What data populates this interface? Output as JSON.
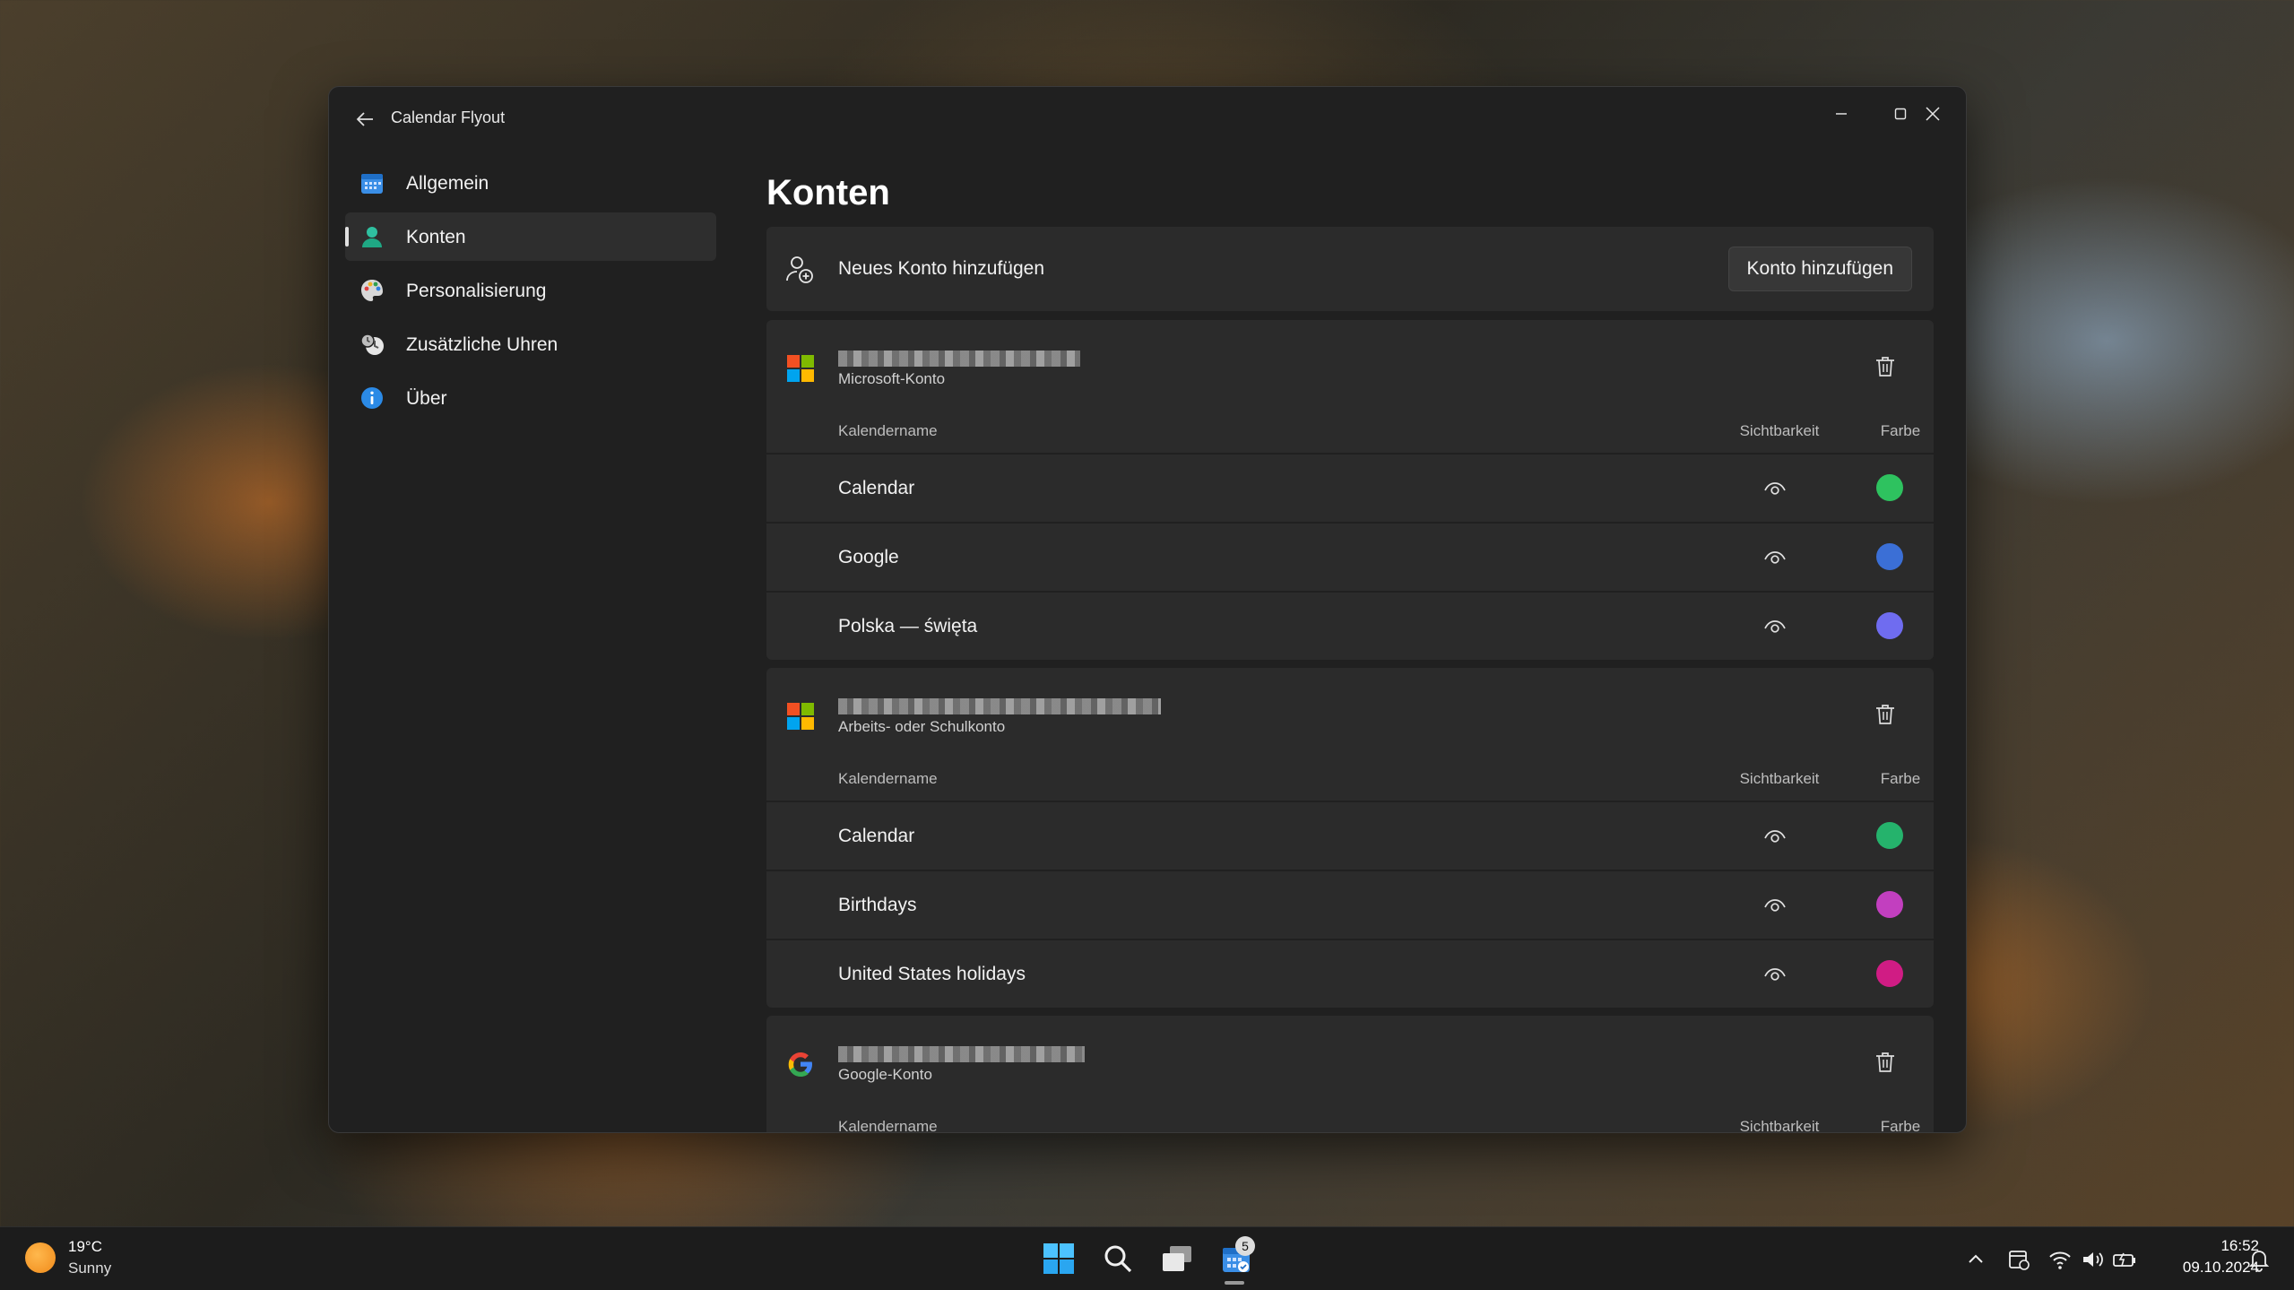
{
  "window": {
    "title": "Calendar Flyout"
  },
  "sidebar": {
    "items": [
      {
        "label": "Allgemein",
        "icon": "calendar-icon",
        "active": false
      },
      {
        "label": "Konten",
        "icon": "person-icon",
        "active": true
      },
      {
        "label": "Personalisierung",
        "icon": "palette-icon",
        "active": false
      },
      {
        "label": "Zusätzliche Uhren",
        "icon": "clock-icon",
        "active": false
      },
      {
        "label": "Über",
        "icon": "info-icon",
        "active": false
      }
    ]
  },
  "main": {
    "title": "Konten",
    "add_account": {
      "text": "Neues Konto hinzufügen",
      "button_label": "Konto hinzufügen"
    },
    "column_headers": {
      "name": "Kalendername",
      "visibility": "Sichtbarkeit",
      "color": "Farbe"
    },
    "accounts": [
      {
        "type_label": "Microsoft-Konto",
        "logo": "microsoft-logo",
        "calendars": [
          {
            "name": "Calendar",
            "color": "#2ec25f"
          },
          {
            "name": "Google",
            "color": "#3b6fd6"
          },
          {
            "name": "Polska — święta",
            "color": "#6f6cf0"
          }
        ]
      },
      {
        "type_label": "Arbeits- oder Schulkonto",
        "logo": "microsoft-logo",
        "calendars": [
          {
            "name": "Calendar",
            "color": "#25b36c"
          },
          {
            "name": "Birthdays",
            "color": "#c23fbf"
          },
          {
            "name": "United States holidays",
            "color": "#d01c84"
          }
        ]
      },
      {
        "type_label": "Google-Konto",
        "logo": "google-logo",
        "calendars": []
      }
    ]
  },
  "taskbar": {
    "weather": {
      "temp": "19°C",
      "condition": "Sunny"
    },
    "calendar_badge": "5",
    "time": "16:52",
    "date": "09.10.2024"
  }
}
